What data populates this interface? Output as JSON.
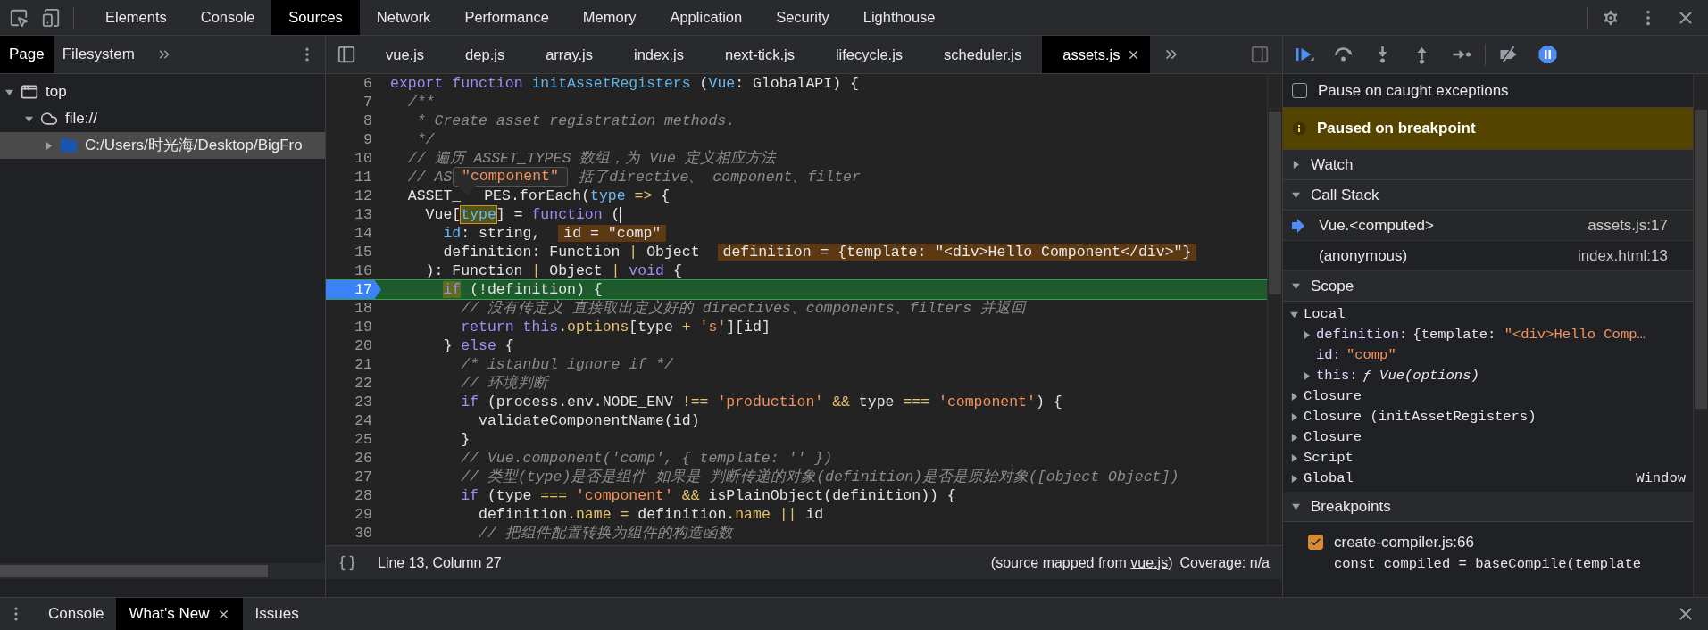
{
  "main_tabs": [
    {
      "label": "Elements",
      "selected": false
    },
    {
      "label": "Console",
      "selected": false
    },
    {
      "label": "Sources",
      "selected": true
    },
    {
      "label": "Network",
      "selected": false
    },
    {
      "label": "Performance",
      "selected": false
    },
    {
      "label": "Memory",
      "selected": false
    },
    {
      "label": "Application",
      "selected": false
    },
    {
      "label": "Security",
      "selected": false
    },
    {
      "label": "Lighthouse",
      "selected": false
    }
  ],
  "navigator": {
    "tabs": [
      {
        "label": "Page",
        "selected": true
      },
      {
        "label": "Filesystem",
        "selected": false
      }
    ],
    "tree": [
      {
        "label": "top",
        "kind": "window",
        "expanded": true,
        "selected": false,
        "children": [
          {
            "label": "file://",
            "kind": "cloud",
            "expanded": true,
            "selected": false,
            "children": [
              {
                "label": "C:/Users/时光海/Desktop/BigFro",
                "kind": "folder",
                "expanded": false,
                "selected": true
              }
            ]
          }
        ]
      }
    ]
  },
  "editor": {
    "tabs": [
      {
        "label": "vue.js",
        "selected": false,
        "closable": false
      },
      {
        "label": "dep.js",
        "selected": false,
        "closable": false
      },
      {
        "label": "array.js",
        "selected": false,
        "closable": false
      },
      {
        "label": "index.js",
        "selected": false,
        "closable": false
      },
      {
        "label": "next-tick.js",
        "selected": false,
        "closable": false
      },
      {
        "label": "lifecycle.js",
        "selected": false,
        "closable": false
      },
      {
        "label": "scheduler.js",
        "selected": false,
        "closable": false
      },
      {
        "label": "assets.js",
        "selected": true,
        "closable": true
      }
    ],
    "tooltip": "\"component\"",
    "lines": [
      {
        "number": "6",
        "current": false,
        "tokens": [
          {
            "kind": "kw",
            "text": "export"
          },
          {
            "kind": "kw",
            "text": " function"
          },
          {
            "kind": "fn",
            "text": " initAssetRegisters"
          },
          {
            "kind": "txt",
            "text": " ("
          },
          {
            "kind": "var",
            "text": "Vue"
          },
          {
            "kind": "txt",
            "text": ": GlobalAPI) {"
          }
        ]
      },
      {
        "number": "7",
        "current": false,
        "tokens": [
          {
            "kind": "cm",
            "text": "  /**"
          }
        ]
      },
      {
        "number": "8",
        "current": false,
        "tokens": [
          {
            "kind": "cm",
            "text": "   * Create asset registration methods."
          }
        ]
      },
      {
        "number": "9",
        "current": false,
        "tokens": [
          {
            "kind": "cm",
            "text": "   */"
          }
        ]
      },
      {
        "number": "10",
        "current": false,
        "tokens": [
          {
            "kind": "cm",
            "text": "  // 遍历 ASSET_TYPES 数组，为 Vue 定义相应方法"
          }
        ]
      },
      {
        "number": "11",
        "current": false,
        "tokens": [
          {
            "kind": "cm",
            "text": "  // AS"
          },
          {
            "kind": "gap"
          },
          {
            "kind": "cm",
            "text": "括了directive、 component、filter"
          }
        ]
      },
      {
        "number": "12",
        "current": false,
        "tokens": [
          {
            "kind": "txt",
            "text": "  ASSET_"
          },
          {
            "kind": "notch"
          },
          {
            "kind": "txt",
            "text": "PES.forEach("
          },
          {
            "kind": "var",
            "text": "type"
          },
          {
            "kind": "op",
            "text": " =>"
          },
          {
            "kind": "txt",
            "text": " {"
          }
        ]
      },
      {
        "number": "13",
        "current": false,
        "tokens": [
          {
            "kind": "txt",
            "text": "    Vue["
          },
          {
            "kind": "hover",
            "text": "type"
          },
          {
            "kind": "txt",
            "text": "] = "
          },
          {
            "kind": "kw",
            "text": "function"
          },
          {
            "kind": "txt",
            "text": " ("
          },
          {
            "kind": "cursor"
          }
        ]
      },
      {
        "number": "14",
        "current": false,
        "tokens": [
          {
            "kind": "var",
            "text": "      id"
          },
          {
            "kind": "txt",
            "text": ": string,"
          },
          {
            "kind": "inline",
            "text": "id = \"comp\""
          }
        ]
      },
      {
        "number": "15",
        "current": false,
        "tokens": [
          {
            "kind": "txt",
            "text": "      definition: Function "
          },
          {
            "kind": "op",
            "text": "|"
          },
          {
            "kind": "txt",
            "text": " Object"
          },
          {
            "kind": "inline",
            "text": "definition = {template: \"<div>Hello Component</div>\"}"
          }
        ]
      },
      {
        "number": "16",
        "current": false,
        "tokens": [
          {
            "kind": "txt",
            "text": "    ): Function "
          },
          {
            "kind": "op",
            "text": "|"
          },
          {
            "kind": "txt",
            "text": " Object "
          },
          {
            "kind": "op",
            "text": "|"
          },
          {
            "kind": "kw",
            "text": " void"
          },
          {
            "kind": "txt",
            "text": " {"
          }
        ]
      },
      {
        "number": "17",
        "current": true,
        "tokens": [
          {
            "kind": "exec",
            "text": "      if"
          },
          {
            "kind": "txt",
            "text": " (!definition) {"
          }
        ]
      },
      {
        "number": "18",
        "current": false,
        "tokens": [
          {
            "kind": "cm",
            "text": "        // 没有传定义 直接取出定义好的 directives、components、filters 并返回"
          }
        ]
      },
      {
        "number": "19",
        "current": false,
        "tokens": [
          {
            "kind": "kw",
            "text": "        return"
          },
          {
            "kind": "kw",
            "text": " this"
          },
          {
            "kind": "txt",
            "text": "."
          },
          {
            "kind": "prop",
            "text": "options"
          },
          {
            "kind": "txt",
            "text": "[type "
          },
          {
            "kind": "op",
            "text": "+"
          },
          {
            "kind": "str",
            "text": " 's'"
          },
          {
            "kind": "txt",
            "text": "][id]"
          }
        ]
      },
      {
        "number": "20",
        "current": false,
        "tokens": [
          {
            "kind": "txt",
            "text": "      } "
          },
          {
            "kind": "kw",
            "text": "else"
          },
          {
            "kind": "txt",
            "text": " {"
          }
        ]
      },
      {
        "number": "21",
        "current": false,
        "tokens": [
          {
            "kind": "cm",
            "text": "        /* istanbul ignore if */"
          }
        ]
      },
      {
        "number": "22",
        "current": false,
        "tokens": [
          {
            "kind": "cm",
            "text": "        // 环境判断"
          }
        ]
      },
      {
        "number": "23",
        "current": false,
        "tokens": [
          {
            "kind": "kw",
            "text": "        if"
          },
          {
            "kind": "txt",
            "text": " (process.env.NODE_ENV "
          },
          {
            "kind": "op",
            "text": "!=="
          },
          {
            "kind": "str",
            "text": " 'production'"
          },
          {
            "kind": "op",
            "text": " &&"
          },
          {
            "kind": "txt",
            "text": " type "
          },
          {
            "kind": "op",
            "text": "==="
          },
          {
            "kind": "str",
            "text": " 'component'"
          },
          {
            "kind": "txt",
            "text": ") {"
          }
        ]
      },
      {
        "number": "24",
        "current": false,
        "tokens": [
          {
            "kind": "txt",
            "text": "          validateComponentName(id)"
          }
        ]
      },
      {
        "number": "25",
        "current": false,
        "tokens": [
          {
            "kind": "txt",
            "text": "        }"
          }
        ]
      },
      {
        "number": "26",
        "current": false,
        "tokens": [
          {
            "kind": "cm",
            "text": "        // Vue.component('comp', { template: '' })"
          }
        ]
      },
      {
        "number": "27",
        "current": false,
        "tokens": [
          {
            "kind": "cm",
            "text": "        // 类型(type)是否是组件 如果是 判断传递的对象(definition)是否是原始对象([object Object])"
          }
        ]
      },
      {
        "number": "28",
        "current": false,
        "tokens": [
          {
            "kind": "kw",
            "text": "        if"
          },
          {
            "kind": "txt",
            "text": " (type "
          },
          {
            "kind": "op",
            "text": "==="
          },
          {
            "kind": "str",
            "text": " 'component'"
          },
          {
            "kind": "op",
            "text": " &&"
          },
          {
            "kind": "txt",
            "text": " isPlainObject(definition)) {"
          }
        ]
      },
      {
        "number": "29",
        "current": false,
        "tokens": [
          {
            "kind": "txt",
            "text": "          definition."
          },
          {
            "kind": "prop",
            "text": "name"
          },
          {
            "kind": "op",
            "text": " ="
          },
          {
            "kind": "txt",
            "text": " definition."
          },
          {
            "kind": "prop",
            "text": "name"
          },
          {
            "kind": "op",
            "text": " ||"
          },
          {
            "kind": "txt",
            "text": " id"
          }
        ]
      },
      {
        "number": "30",
        "current": false,
        "tokens": [
          {
            "kind": "cm",
            "text": "          // 把组件配置转换为组件的构造函数"
          }
        ]
      }
    ],
    "status": {
      "position": "Line 13, Column 27",
      "source_before": "(source mapped from ",
      "source_link": "vue.js",
      "source_after": ")",
      "coverage": "Coverage: n/a"
    }
  },
  "debugger": {
    "pause_on_caught": {
      "label": "Pause on caught exceptions",
      "checked": false
    },
    "banner": "Paused on breakpoint",
    "watch": {
      "title": "Watch",
      "expanded": false
    },
    "call_stack": {
      "title": "Call Stack",
      "expanded": true,
      "frames": [
        {
          "name": "Vue.<computed>",
          "location": "assets.js:17",
          "selected": true
        },
        {
          "name": "(anonymous)",
          "location": "index.html:13",
          "selected": false
        }
      ]
    },
    "scope": {
      "title": "Scope",
      "expanded": true,
      "groups": [
        {
          "label": "Local",
          "expanded": true,
          "variables": [
            {
              "name": "definition:",
              "expandable": true,
              "value": [
                {
                  "kind": "txt",
                  "text": "{template: "
                },
                {
                  "kind": "str",
                  "text": "\"<div>Hello Comp…"
                }
              ]
            },
            {
              "name": "id:",
              "expandable": false,
              "value": [
                {
                  "kind": "str",
                  "text": "\"comp\""
                }
              ]
            },
            {
              "name": "this:",
              "expandable": true,
              "value": [
                {
                  "kind": "fn",
                  "text": "ƒ Vue(options)"
                }
              ]
            }
          ]
        },
        {
          "label": "Closure",
          "expanded": false
        },
        {
          "label": "Closure (initAssetRegisters)",
          "expanded": false
        },
        {
          "label": "Closure",
          "expanded": false
        },
        {
          "label": "Script",
          "expanded": false
        },
        {
          "label": "Global",
          "expanded": false,
          "value": "Window"
        }
      ]
    },
    "breakpoints": {
      "title": "Breakpoints",
      "expanded": true,
      "items": [
        {
          "label": "create-compiler.js:66",
          "checked": true,
          "code": "const compiled = baseCompile(template"
        }
      ]
    }
  },
  "drawer": {
    "tabs": [
      {
        "label": "Console",
        "selected": false,
        "closable": false
      },
      {
        "label": "What's New",
        "selected": true,
        "closable": true
      },
      {
        "label": "Issues",
        "selected": false,
        "closable": false
      }
    ]
  }
}
